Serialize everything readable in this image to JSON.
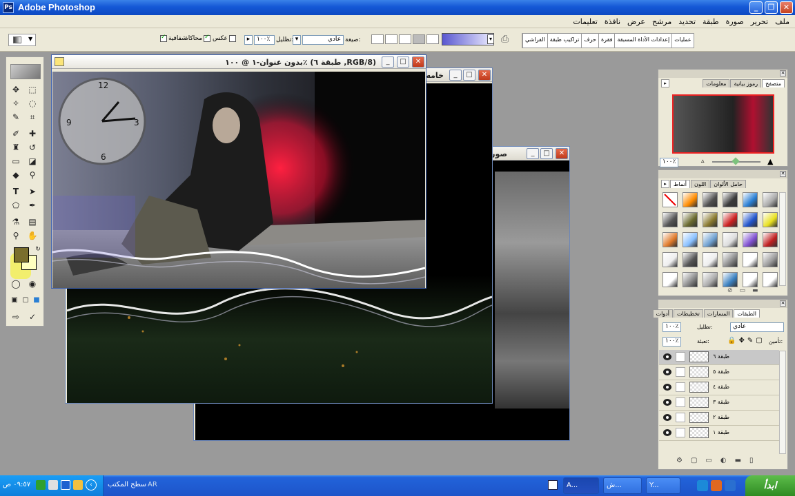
{
  "app": {
    "title": "Adobe Photoshop"
  },
  "menu": {
    "items": [
      "ملف",
      "تحرير",
      "صورة",
      "طبقة",
      "تحديد",
      "مرشح",
      "عرض",
      "نافذة",
      "تعليمات"
    ]
  },
  "options": {
    "transparency_label": "شفافية",
    "dither_label": "محاكاة",
    "reverse_label": "عكس",
    "opacity_label": "تظليل:",
    "opacity_value": "١٠٠٪",
    "mode_label": "صيغة:",
    "mode_value": "عادي",
    "palette_tabs": [
      "عمليات",
      "إعدادات الأداة المسبقة",
      "فقرة",
      "حرف",
      "تراكيب طبقة",
      "الفراشي"
    ]
  },
  "documents": [
    {
      "title": "بدون عنوان-١ @ ١٠٠٪ (طبقة ٦ ,RGB/8)"
    },
    {
      "title": "خامه"
    },
    {
      "title": "صورة"
    }
  ],
  "navigator": {
    "tabs": [
      "متصفح",
      "رموز بيانية",
      "معلومات"
    ],
    "zoom_value": "١٠٠٪"
  },
  "styles": {
    "tabs": [
      "أنماط",
      "اللون",
      "حامل الألوان"
    ],
    "swatch_colors": [
      "#ff3030",
      "#ff8c00",
      "#505050",
      "#3a3a3a",
      "#2a7fd4",
      "#aaaaaa",
      "#555555",
      "#6b6b30",
      "#8a7a30",
      "#cc2020",
      "#2255cc",
      "#e8e020",
      "#e07a2a",
      "#88c0ff",
      "#6fa0d0",
      "#dddddd",
      "#8050d0",
      "#c02020",
      "#eeeeee",
      "#555555",
      "#eeeeee",
      "#888888",
      "#ffffff",
      "#999999",
      "#ffffff",
      "#888888",
      "#aaaaaa",
      "#3a80c0",
      "#ffffff",
      "#ffffff"
    ]
  },
  "layers": {
    "tabs": [
      "الطبقات",
      "المسارات",
      "تخطيطات",
      "أدوات"
    ],
    "blend_mode": "عادي",
    "opacity_label": "تظليل:",
    "opacity_value": "١٠٠٪",
    "lock_label": "تأمين:",
    "fill_label": "تعبئة:",
    "fill_value": "١٠٠٪",
    "rows": [
      {
        "name": "طبقة ٦",
        "selected": true
      },
      {
        "name": "طبقة ٥",
        "selected": false
      },
      {
        "name": "طبقة ٤",
        "selected": false
      },
      {
        "name": "طبقة ٣",
        "selected": false
      },
      {
        "name": "طبقة ٢",
        "selected": false
      },
      {
        "name": "طبقة ١",
        "selected": false
      }
    ]
  },
  "taskbar": {
    "start_label": "ابدأ",
    "clock": "٠٩:٥٧ ص",
    "desktop_label": "سطح المكتب",
    "lang": "AR",
    "tasks": [
      "A...",
      "ش...",
      "Y..."
    ]
  }
}
